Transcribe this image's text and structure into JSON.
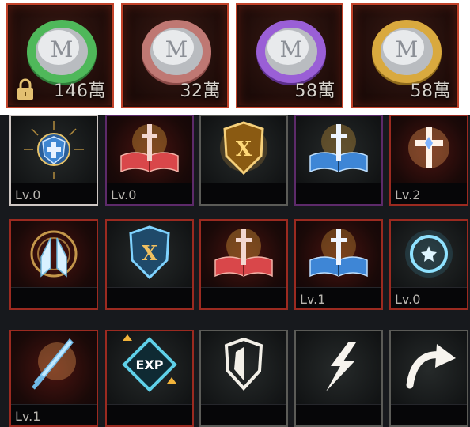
{
  "coins": [
    {
      "color": "#3fa04a",
      "amount": "146萬",
      "locked": true,
      "icon": "green-coin-icon"
    },
    {
      "color": "#b66a66",
      "amount": "32萬",
      "locked": false,
      "icon": "rose-coin-icon"
    },
    {
      "color": "#8a4fc4",
      "amount": "58萬",
      "locked": false,
      "icon": "purple-coin-icon"
    },
    {
      "color": "#c8962e",
      "amount": "58萬",
      "locked": false,
      "icon": "gold-coin-icon"
    }
  ],
  "skills": [
    {
      "icon": "blue-cross-shield-icon",
      "level": "Lv.0",
      "border": "white"
    },
    {
      "icon": "red-book-sword-icon",
      "level": "Lv.0",
      "border": "purple"
    },
    {
      "icon": "gold-crest-shield-icon",
      "level": "",
      "border": "gray"
    },
    {
      "icon": "blue-book-sword-icon",
      "level": "",
      "border": "purple"
    },
    {
      "icon": "white-cross-icon",
      "level": "Lv.2",
      "border": "red"
    },
    {
      "icon": "praying-hands-icon",
      "level": "",
      "border": "red"
    },
    {
      "icon": "blue-crest-shield-icon",
      "level": "",
      "border": "red"
    },
    {
      "icon": "red-book-sword-icon",
      "level": "",
      "border": "red"
    },
    {
      "icon": "blue-book-sword-icon",
      "level": "Lv.1",
      "border": "red"
    },
    {
      "icon": "star-ring-icon",
      "level": "Lv.0",
      "border": "red"
    },
    {
      "icon": "glowing-sword-icon",
      "level": "Lv.1",
      "border": "red"
    },
    {
      "icon": "exp-boost-icon",
      "level": "",
      "border": "red"
    },
    {
      "icon": "split-shield-icon",
      "level": "",
      "border": "gray"
    },
    {
      "icon": "lightning-bolt-icon",
      "level": "",
      "border": "gray"
    },
    {
      "icon": "curved-arrow-icon",
      "level": "",
      "border": "gray"
    }
  ]
}
